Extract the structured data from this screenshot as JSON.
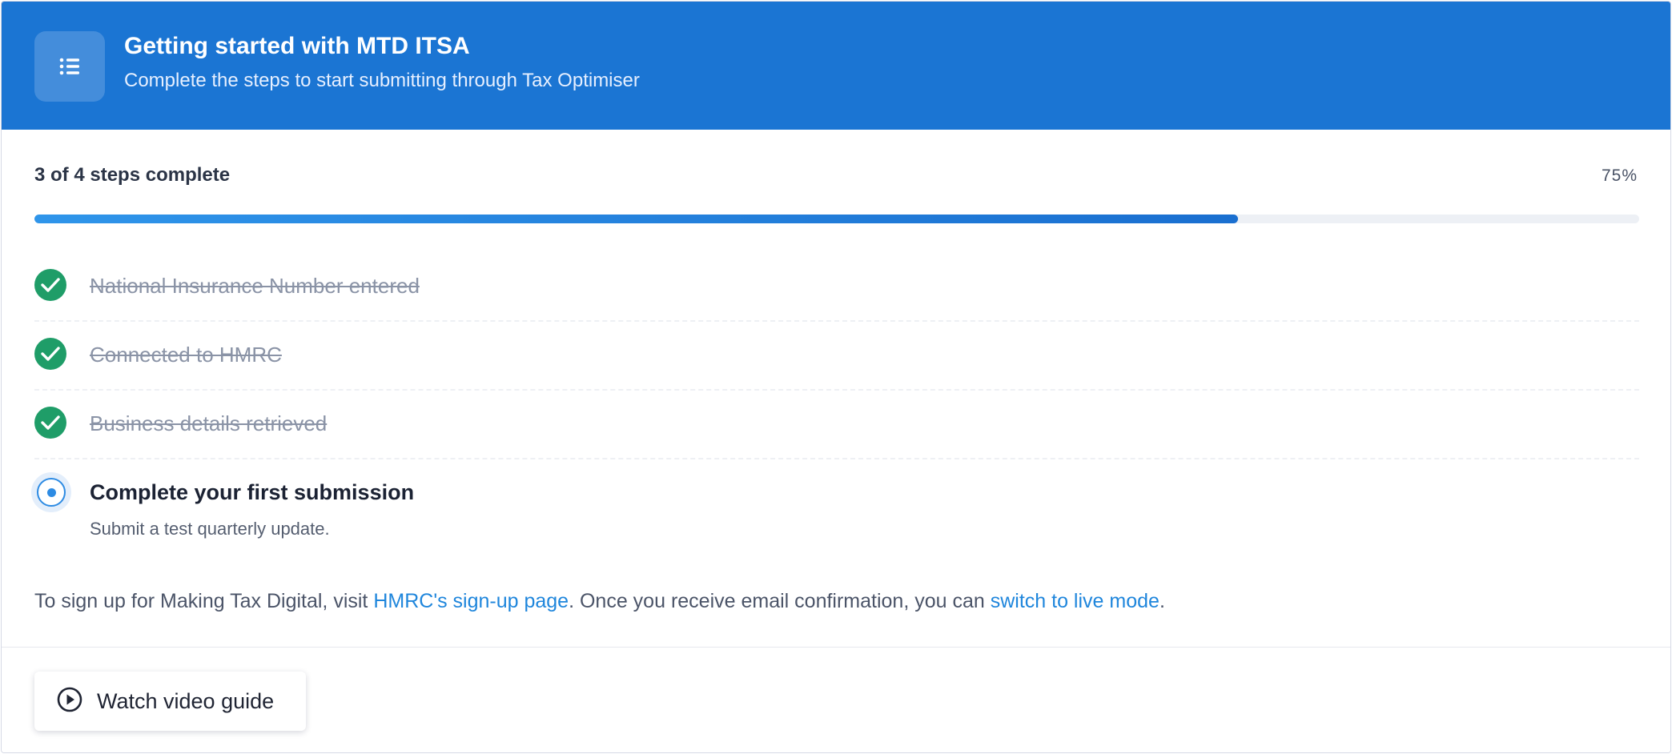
{
  "header": {
    "title": "Getting started with MTD ITSA",
    "subtitle": "Complete the steps to start submitting through Tax Optimiser",
    "icon": "list-icon",
    "background_color": "#1b75d3"
  },
  "progress": {
    "label": "3 of 4 steps complete",
    "percent_label": "75%",
    "completed": 3,
    "total": 4,
    "fraction": 0.75
  },
  "steps": [
    {
      "label": "National Insurance Number entered",
      "status": "complete"
    },
    {
      "label": "Connected to HMRC",
      "status": "complete"
    },
    {
      "label": "Business details retrieved",
      "status": "complete"
    },
    {
      "label": "Complete your first submission",
      "description": "Submit a test quarterly update.",
      "status": "current"
    }
  ],
  "signup": {
    "prefix": "To sign up for Making Tax Digital, visit ",
    "link1": "HMRC's sign-up page",
    "middle": ". Once you receive email confirmation, you can ",
    "link2": "switch to live mode",
    "suffix": "."
  },
  "footer": {
    "video_button_label": "Watch video guide",
    "video_icon": "play-circle-icon"
  },
  "colors": {
    "accent": "#1b75d3",
    "success": "#1f9d68",
    "link": "#1f86dc"
  }
}
